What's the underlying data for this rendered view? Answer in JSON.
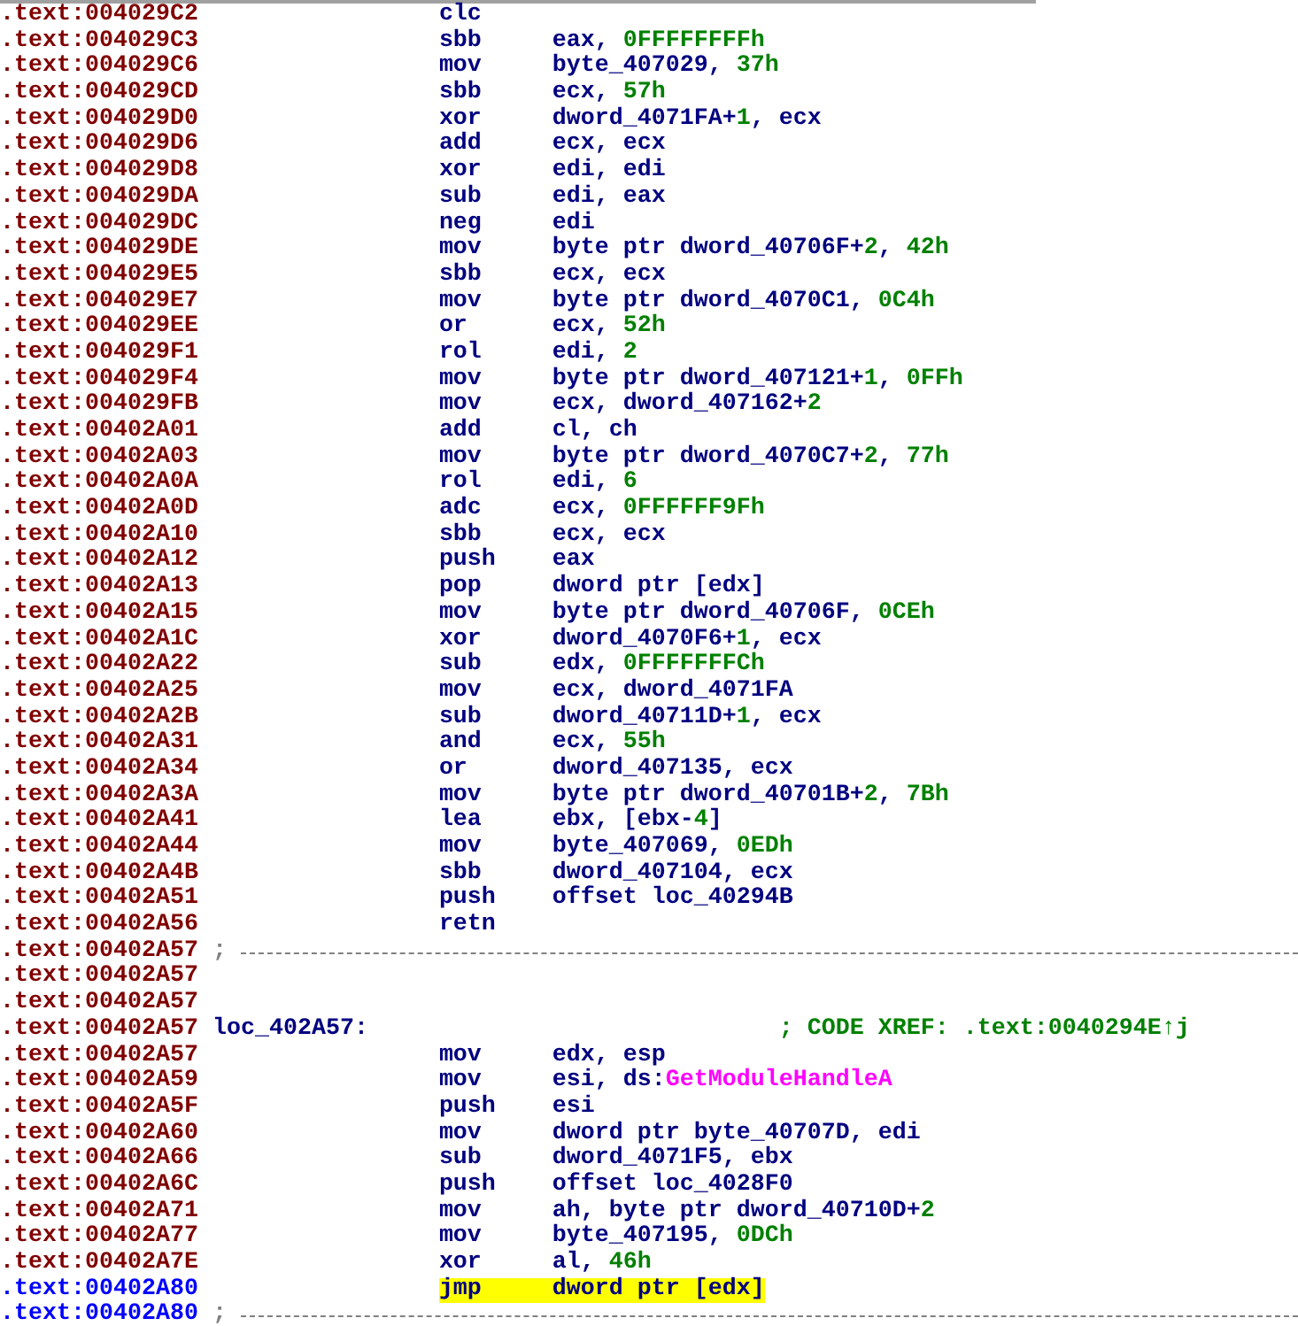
{
  "listing": [
    {
      "kind": "instr",
      "address": ".text:004029C2",
      "current": false,
      "highlighted": false,
      "mnemonic": "clc"
    },
    {
      "kind": "instr",
      "address": ".text:004029C3",
      "current": false,
      "highlighted": false,
      "mnemonic": "sbb",
      "operands": [
        {
          "text": "eax, ",
          "kind": "reg"
        },
        {
          "text": "0FFFFFFFFh",
          "kind": "num"
        }
      ]
    },
    {
      "kind": "instr",
      "address": ".text:004029C6",
      "current": false,
      "highlighted": false,
      "mnemonic": "mov",
      "operands": [
        {
          "text": "byte_407029, ",
          "kind": "reg"
        },
        {
          "text": "37h",
          "kind": "num"
        }
      ]
    },
    {
      "kind": "instr",
      "address": ".text:004029CD",
      "current": false,
      "highlighted": false,
      "mnemonic": "sbb",
      "operands": [
        {
          "text": "ecx, ",
          "kind": "reg"
        },
        {
          "text": "57h",
          "kind": "num"
        }
      ]
    },
    {
      "kind": "instr",
      "address": ".text:004029D0",
      "current": false,
      "highlighted": false,
      "mnemonic": "xor",
      "operands": [
        {
          "text": "dword_4071FA+",
          "kind": "reg"
        },
        {
          "text": "1",
          "kind": "num"
        },
        {
          "text": ", ecx",
          "kind": "reg"
        }
      ]
    },
    {
      "kind": "instr",
      "address": ".text:004029D6",
      "current": false,
      "highlighted": false,
      "mnemonic": "add",
      "operands": [
        {
          "text": "ecx, ecx",
          "kind": "reg"
        }
      ]
    },
    {
      "kind": "instr",
      "address": ".text:004029D8",
      "current": false,
      "highlighted": false,
      "mnemonic": "xor",
      "operands": [
        {
          "text": "edi, edi",
          "kind": "reg"
        }
      ]
    },
    {
      "kind": "instr",
      "address": ".text:004029DA",
      "current": false,
      "highlighted": false,
      "mnemonic": "sub",
      "operands": [
        {
          "text": "edi, eax",
          "kind": "reg"
        }
      ]
    },
    {
      "kind": "instr",
      "address": ".text:004029DC",
      "current": false,
      "highlighted": false,
      "mnemonic": "neg",
      "operands": [
        {
          "text": "edi",
          "kind": "reg"
        }
      ]
    },
    {
      "kind": "instr",
      "address": ".text:004029DE",
      "current": false,
      "highlighted": false,
      "mnemonic": "mov",
      "operands": [
        {
          "text": "byte ptr dword_40706F+",
          "kind": "reg"
        },
        {
          "text": "2",
          "kind": "num"
        },
        {
          "text": ", ",
          "kind": "reg"
        },
        {
          "text": "42h",
          "kind": "num"
        }
      ]
    },
    {
      "kind": "instr",
      "address": ".text:004029E5",
      "current": false,
      "highlighted": false,
      "mnemonic": "sbb",
      "operands": [
        {
          "text": "ecx, ecx",
          "kind": "reg"
        }
      ]
    },
    {
      "kind": "instr",
      "address": ".text:004029E7",
      "current": false,
      "highlighted": false,
      "mnemonic": "mov",
      "operands": [
        {
          "text": "byte ptr dword_4070C1, ",
          "kind": "reg"
        },
        {
          "text": "0C4h",
          "kind": "num"
        }
      ]
    },
    {
      "kind": "instr",
      "address": ".text:004029EE",
      "current": false,
      "highlighted": false,
      "mnemonic": "or",
      "operands": [
        {
          "text": "ecx, ",
          "kind": "reg"
        },
        {
          "text": "52h",
          "kind": "num"
        }
      ]
    },
    {
      "kind": "instr",
      "address": ".text:004029F1",
      "current": false,
      "highlighted": false,
      "mnemonic": "rol",
      "operands": [
        {
          "text": "edi, ",
          "kind": "reg"
        },
        {
          "text": "2",
          "kind": "num"
        }
      ]
    },
    {
      "kind": "instr",
      "address": ".text:004029F4",
      "current": false,
      "highlighted": false,
      "mnemonic": "mov",
      "operands": [
        {
          "text": "byte ptr dword_407121+",
          "kind": "reg"
        },
        {
          "text": "1",
          "kind": "num"
        },
        {
          "text": ", ",
          "kind": "reg"
        },
        {
          "text": "0FFh",
          "kind": "num"
        }
      ]
    },
    {
      "kind": "instr",
      "address": ".text:004029FB",
      "current": false,
      "highlighted": false,
      "mnemonic": "mov",
      "operands": [
        {
          "text": "ecx, dword_407162+",
          "kind": "reg"
        },
        {
          "text": "2",
          "kind": "num"
        }
      ]
    },
    {
      "kind": "instr",
      "address": ".text:00402A01",
      "current": false,
      "highlighted": false,
      "mnemonic": "add",
      "operands": [
        {
          "text": "cl, ch",
          "kind": "reg"
        }
      ]
    },
    {
      "kind": "instr",
      "address": ".text:00402A03",
      "current": false,
      "highlighted": false,
      "mnemonic": "mov",
      "operands": [
        {
          "text": "byte ptr dword_4070C7+",
          "kind": "reg"
        },
        {
          "text": "2",
          "kind": "num"
        },
        {
          "text": ", ",
          "kind": "reg"
        },
        {
          "text": "77h",
          "kind": "num"
        }
      ]
    },
    {
      "kind": "instr",
      "address": ".text:00402A0A",
      "current": false,
      "highlighted": false,
      "mnemonic": "rol",
      "operands": [
        {
          "text": "edi, ",
          "kind": "reg"
        },
        {
          "text": "6",
          "kind": "num"
        }
      ]
    },
    {
      "kind": "instr",
      "address": ".text:00402A0D",
      "current": false,
      "highlighted": false,
      "mnemonic": "adc",
      "operands": [
        {
          "text": "ecx, ",
          "kind": "reg"
        },
        {
          "text": "0FFFFFF9Fh",
          "kind": "num"
        }
      ]
    },
    {
      "kind": "instr",
      "address": ".text:00402A10",
      "current": false,
      "highlighted": false,
      "mnemonic": "sbb",
      "operands": [
        {
          "text": "ecx, ecx",
          "kind": "reg"
        }
      ]
    },
    {
      "kind": "instr",
      "address": ".text:00402A12",
      "current": false,
      "highlighted": false,
      "mnemonic": "push",
      "operands": [
        {
          "text": "eax",
          "kind": "reg"
        }
      ]
    },
    {
      "kind": "instr",
      "address": ".text:00402A13",
      "current": false,
      "highlighted": false,
      "mnemonic": "pop",
      "operands": [
        {
          "text": "dword ptr [edx]",
          "kind": "reg"
        }
      ]
    },
    {
      "kind": "instr",
      "address": ".text:00402A15",
      "current": false,
      "highlighted": false,
      "mnemonic": "mov",
      "operands": [
        {
          "text": "byte ptr dword_40706F, ",
          "kind": "reg"
        },
        {
          "text": "0CEh",
          "kind": "num"
        }
      ]
    },
    {
      "kind": "instr",
      "address": ".text:00402A1C",
      "current": false,
      "highlighted": false,
      "mnemonic": "xor",
      "operands": [
        {
          "text": "dword_4070F6+",
          "kind": "reg"
        },
        {
          "text": "1",
          "kind": "num"
        },
        {
          "text": ", ecx",
          "kind": "reg"
        }
      ]
    },
    {
      "kind": "instr",
      "address": ".text:00402A22",
      "current": false,
      "highlighted": false,
      "mnemonic": "sub",
      "operands": [
        {
          "text": "edx, ",
          "kind": "reg"
        },
        {
          "text": "0FFFFFFFCh",
          "kind": "num"
        }
      ]
    },
    {
      "kind": "instr",
      "address": ".text:00402A25",
      "current": false,
      "highlighted": false,
      "mnemonic": "mov",
      "operands": [
        {
          "text": "ecx, dword_4071FA",
          "kind": "reg"
        }
      ]
    },
    {
      "kind": "instr",
      "address": ".text:00402A2B",
      "current": false,
      "highlighted": false,
      "mnemonic": "sub",
      "operands": [
        {
          "text": "dword_40711D+",
          "kind": "reg"
        },
        {
          "text": "1",
          "kind": "num"
        },
        {
          "text": ", ecx",
          "kind": "reg"
        }
      ]
    },
    {
      "kind": "instr",
      "address": ".text:00402A31",
      "current": false,
      "highlighted": false,
      "mnemonic": "and",
      "operands": [
        {
          "text": "ecx, ",
          "kind": "reg"
        },
        {
          "text": "55h",
          "kind": "num"
        }
      ]
    },
    {
      "kind": "instr",
      "address": ".text:00402A34",
      "current": false,
      "highlighted": false,
      "mnemonic": "or",
      "operands": [
        {
          "text": "dword_407135, ecx",
          "kind": "reg"
        }
      ]
    },
    {
      "kind": "instr",
      "address": ".text:00402A3A",
      "current": false,
      "highlighted": false,
      "mnemonic": "mov",
      "operands": [
        {
          "text": "byte ptr dword_40701B+",
          "kind": "reg"
        },
        {
          "text": "2",
          "kind": "num"
        },
        {
          "text": ", ",
          "kind": "reg"
        },
        {
          "text": "7Bh",
          "kind": "num"
        }
      ]
    },
    {
      "kind": "instr",
      "address": ".text:00402A41",
      "current": false,
      "highlighted": false,
      "mnemonic": "lea",
      "operands": [
        {
          "text": "ebx, [ebx-",
          "kind": "reg"
        },
        {
          "text": "4",
          "kind": "num"
        },
        {
          "text": "]",
          "kind": "reg"
        }
      ]
    },
    {
      "kind": "instr",
      "address": ".text:00402A44",
      "current": false,
      "highlighted": false,
      "mnemonic": "mov",
      "operands": [
        {
          "text": "byte_407069, ",
          "kind": "reg"
        },
        {
          "text": "0EDh",
          "kind": "num"
        }
      ]
    },
    {
      "kind": "instr",
      "address": ".text:00402A4B",
      "current": false,
      "highlighted": false,
      "mnemonic": "sbb",
      "operands": [
        {
          "text": "dword_407104, ecx",
          "kind": "reg"
        }
      ]
    },
    {
      "kind": "instr",
      "address": ".text:00402A51",
      "current": false,
      "highlighted": false,
      "mnemonic": "push",
      "operands": [
        {
          "text": "offset loc_40294B",
          "kind": "reg"
        }
      ]
    },
    {
      "kind": "instr",
      "address": ".text:00402A56",
      "current": false,
      "highlighted": false,
      "mnemonic": "retn"
    },
    {
      "kind": "separator",
      "address": ".text:00402A57",
      "current": false,
      "marker": ";"
    },
    {
      "kind": "blank",
      "address": ".text:00402A57",
      "current": false
    },
    {
      "kind": "blank",
      "address": ".text:00402A57",
      "current": false
    },
    {
      "kind": "label",
      "address": ".text:00402A57",
      "current": false,
      "label": "loc_402A57:",
      "comment": "; CODE XREF: .text:0040294E↑j"
    },
    {
      "kind": "instr",
      "address": ".text:00402A57",
      "current": false,
      "highlighted": false,
      "mnemonic": "mov",
      "operands": [
        {
          "text": "edx, esp",
          "kind": "reg"
        }
      ]
    },
    {
      "kind": "instr",
      "address": ".text:00402A59",
      "current": false,
      "highlighted": false,
      "mnemonic": "mov",
      "operands": [
        {
          "text": "esi, ds:",
          "kind": "reg"
        },
        {
          "text": "GetModuleHandleA",
          "kind": "import"
        }
      ]
    },
    {
      "kind": "instr",
      "address": ".text:00402A5F",
      "current": false,
      "highlighted": false,
      "mnemonic": "push",
      "operands": [
        {
          "text": "esi",
          "kind": "reg"
        }
      ]
    },
    {
      "kind": "instr",
      "address": ".text:00402A60",
      "current": false,
      "highlighted": false,
      "mnemonic": "mov",
      "operands": [
        {
          "text": "dword ptr byte_40707D, edi",
          "kind": "reg"
        }
      ]
    },
    {
      "kind": "instr",
      "address": ".text:00402A66",
      "current": false,
      "highlighted": false,
      "mnemonic": "sub",
      "operands": [
        {
          "text": "dword_4071F5, ebx",
          "kind": "reg"
        }
      ]
    },
    {
      "kind": "instr",
      "address": ".text:00402A6C",
      "current": false,
      "highlighted": false,
      "mnemonic": "push",
      "operands": [
        {
          "text": "offset loc_4028F0",
          "kind": "reg"
        }
      ]
    },
    {
      "kind": "instr",
      "address": ".text:00402A71",
      "current": false,
      "highlighted": false,
      "mnemonic": "mov",
      "operands": [
        {
          "text": "ah, byte ptr dword_40710D+",
          "kind": "reg"
        },
        {
          "text": "2",
          "kind": "num"
        }
      ]
    },
    {
      "kind": "instr",
      "address": ".text:00402A77",
      "current": false,
      "highlighted": false,
      "mnemonic": "mov",
      "operands": [
        {
          "text": "byte_407195, ",
          "kind": "reg"
        },
        {
          "text": "0DCh",
          "kind": "num"
        }
      ]
    },
    {
      "kind": "instr",
      "address": ".text:00402A7E",
      "current": false,
      "highlighted": false,
      "mnemonic": "xor",
      "operands": [
        {
          "text": "al, ",
          "kind": "reg"
        },
        {
          "text": "46h",
          "kind": "num"
        }
      ]
    },
    {
      "kind": "instr",
      "address": ".text:00402A80",
      "current": true,
      "highlighted": true,
      "mnemonic": "jmp",
      "operands": [
        {
          "text": "dword ptr [edx]",
          "kind": "reg"
        }
      ]
    },
    {
      "kind": "separator",
      "address": ".text:00402A80",
      "current": true,
      "marker": ";"
    }
  ]
}
